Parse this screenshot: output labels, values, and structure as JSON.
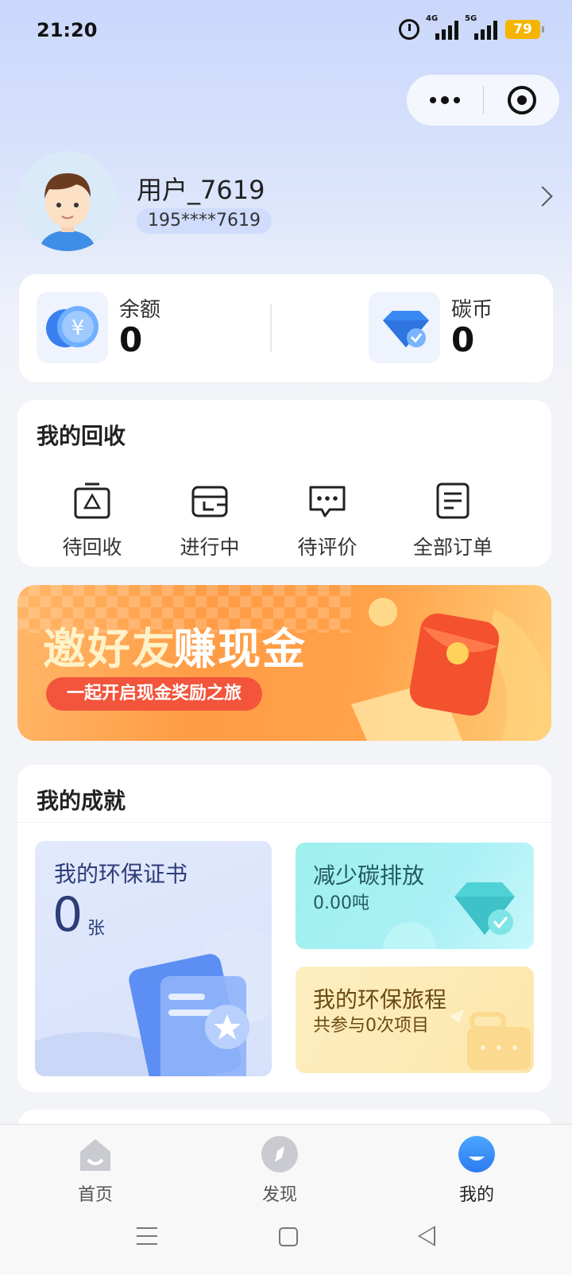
{
  "status_bar": {
    "time": "21:20",
    "network_1": "4G",
    "network_2": "5G",
    "battery": "79"
  },
  "profile": {
    "username": "用户_7619",
    "phone": "195****7619"
  },
  "wallet": {
    "balance_label": "余额",
    "balance_value": "0",
    "coin_label": "碳币",
    "coin_value": "0"
  },
  "recycle": {
    "title": "我的回收",
    "items": [
      {
        "label": "待回收",
        "icon": "recycle-bin-icon"
      },
      {
        "label": "进行中",
        "icon": "truck-icon"
      },
      {
        "label": "待评价",
        "icon": "chat-bubble-icon"
      },
      {
        "label": "全部订单",
        "icon": "order-list-icon"
      }
    ]
  },
  "banner": {
    "title_part1": "邀好友",
    "title_part2": "赚现金",
    "subtitle": "一起开启现金奖励之旅"
  },
  "achievements": {
    "title": "我的成就",
    "certificate": {
      "title": "我的环保证书",
      "count": "0",
      "unit": "张"
    },
    "carbon": {
      "title": "减少碳排放",
      "value": "0.00吨"
    },
    "journey": {
      "title": "我的环保旅程",
      "value": "共参与0次项目"
    }
  },
  "tabbar": [
    {
      "label": "首页",
      "icon": "home-icon"
    },
    {
      "label": "发现",
      "icon": "compass-icon"
    },
    {
      "label": "我的",
      "icon": "profile-icon",
      "active": true
    }
  ],
  "colors": {
    "accent": "#3a8ff7",
    "banner_red": "#f2543c",
    "banner_orange": "#ff9c45"
  }
}
